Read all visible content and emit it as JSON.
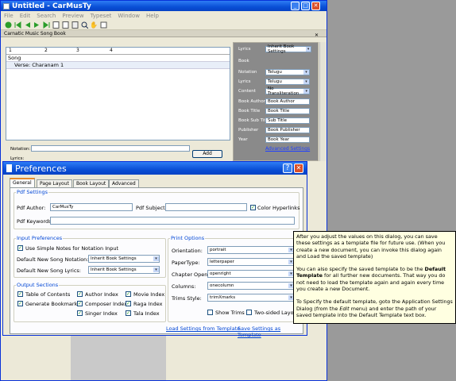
{
  "app": {
    "title": "Untitled - CarMusTy"
  },
  "menu": [
    "File",
    "Edit",
    "Search",
    "Preview",
    "Typeset",
    "Window",
    "Help"
  ],
  "toolbar_icons": [
    "run-icon",
    "first-icon",
    "prev-icon",
    "next-icon",
    "last-icon",
    "new-page-icon",
    "page-icon",
    "page-alt-icon",
    "zoom-icon",
    "hand-icon",
    "fit-icon"
  ],
  "panel": {
    "title": "Carnatic Music Song Book"
  },
  "ruler": [
    "1",
    "2",
    "3",
    "4"
  ],
  "doc": {
    "line1": "Song",
    "line2": "Verse: Charanam 1"
  },
  "notation": {
    "label1": "Notation:",
    "label2": "Lyrics:",
    "add": "Add"
  },
  "side": {
    "lyrics_label": "Lyrics",
    "lyrics_value": "Inherit Book Settings",
    "book_header": "Book",
    "rows": [
      {
        "label": "Notation",
        "value": "Telugu",
        "type": "select"
      },
      {
        "label": "Lyrics",
        "value": "Telugu",
        "type": "select"
      },
      {
        "label": "Content",
        "value": "No Transliteration",
        "type": "select"
      },
      {
        "label": "Book Author",
        "value": "Book Author",
        "type": "input"
      },
      {
        "label": "Book Title",
        "value": "Book Title",
        "type": "input"
      },
      {
        "label": "Book Sub Title",
        "value": "Sub Title",
        "type": "input"
      },
      {
        "label": "Publisher",
        "value": "Book Publisher",
        "type": "input"
      },
      {
        "label": "Year",
        "value": "Book Year",
        "type": "input"
      }
    ],
    "advanced": "Advanced Settings"
  },
  "dialog": {
    "title": "Preferences",
    "tabs": [
      "General",
      "Page Layout",
      "Book Layout",
      "Advanced"
    ],
    "pdf": {
      "group": "Pdf Settings",
      "author_label": "Pdf Author:",
      "author_value": "CarMusTy",
      "subject_label": "Pdf Subject:",
      "subject_value": "",
      "hyperlinks": "Color Hyperlinks",
      "keywords_label": "Pdf Keywords:",
      "keywords_value": ""
    },
    "input": {
      "group": "Input Preferences",
      "simple_notes": "Use Simple Notes for Notation Input",
      "notation_label": "Default New Song Notation:",
      "notation_value": "Inherit Book Settings",
      "lyrics_label": "Default New Song Lyrics:",
      "lyrics_value": "Inherit Book Settings"
    },
    "output": {
      "group": "Output Sections",
      "items": [
        "Table of Contents",
        "Author Index",
        "Movie Index",
        "Generate Bookmarks",
        "Composer Index",
        "Raga Index",
        "Singer Index",
        "Tala Index"
      ]
    },
    "print": {
      "group": "Print Options",
      "rows": [
        {
          "label": "Orientation:",
          "value": "portrait"
        },
        {
          "label": "PaperType:",
          "value": "letterpaper"
        },
        {
          "label": "Chapter Open:",
          "value": "openright"
        },
        {
          "label": "Columns:",
          "value": "onecolumn"
        },
        {
          "label": "Trims Style:",
          "value": "trimXmarks"
        }
      ],
      "show_trims": "Show Trims",
      "two_sided": "Two-sided Layout"
    },
    "load_link": "Load Settings from Template",
    "save_link": "Save Settings as Template"
  },
  "tooltip": {
    "p1": "After you adjust the values on this dialog, you can save these settings as a template file for future use. (When you create a new document, you can invoke this dialog again and Load the saved template)",
    "p2a": "You can also specify the saved template to be the ",
    "p2b": "Default Template",
    "p2c": " for all further new documents. That way you do not need to load the template again and again every time you create a new Document.",
    "p3a": "To Specify the default template, goto the Application Settings Dialog (from the ",
    "p3b": "Edit",
    "p3c": " menu) and enter the path of your saved template into the Default Template text box."
  }
}
